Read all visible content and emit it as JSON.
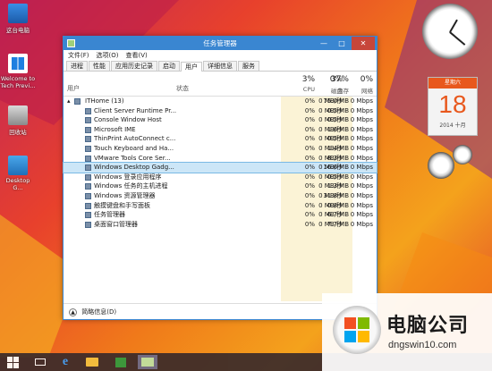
{
  "desktop": {
    "icons": [
      {
        "label": "这台电脑",
        "icon": "computer-icon"
      },
      {
        "label": "Welcome to Tech Previ...",
        "icon": "windows-icon"
      },
      {
        "label": "回收站",
        "icon": "recycle-bin-icon"
      },
      {
        "label": "Desktop G...",
        "icon": "desktop-gadgets-icon"
      }
    ],
    "calendar": {
      "weekday": "星期六",
      "day": "18",
      "year_month": "2014 十月"
    }
  },
  "window": {
    "title": "任务管理器",
    "controls": {
      "minimize": "—",
      "maximize": "□",
      "close": "✕"
    }
  },
  "menu": [
    "文件(F)",
    "选项(O)",
    "查看(V)"
  ],
  "tabs": [
    "进程",
    "性能",
    "应用历史记录",
    "启动",
    "用户",
    "详细信息",
    "服务"
  ],
  "active_tab": "用户",
  "columns": {
    "user": "用户",
    "status": "状态",
    "cpu_pct": "3%",
    "cpu": "CPU",
    "mem_pct": "37%",
    "mem": "内存",
    "disk_pct": "0%",
    "disk": "磁盘",
    "net_pct": "0%",
    "net": "网络"
  },
  "rows": [
    {
      "name": "ITHome (13)",
      "cpu": "0%",
      "mem": "75.0 MB",
      "disk": "0 MB/秒",
      "net": "0 Mbps",
      "group": true
    },
    {
      "name": "Client Server Runtime Pr...",
      "cpu": "0%",
      "mem": "0.5 MB",
      "disk": "0 MB/秒",
      "net": "0 Mbps"
    },
    {
      "name": "Console Window Host",
      "cpu": "0%",
      "mem": "0.5 MB",
      "disk": "0 MB/秒",
      "net": "0 Mbps"
    },
    {
      "name": "Microsoft IME",
      "cpu": "0%",
      "mem": "1.6 MB",
      "disk": "0 MB/秒",
      "net": "0 Mbps"
    },
    {
      "name": "ThinPrint AutoConnect c...",
      "cpu": "0%",
      "mem": "0.5 MB",
      "disk": "0 MB/秒",
      "net": "0 Mbps"
    },
    {
      "name": "Touch Keyboard and Ha...",
      "cpu": "0%",
      "mem": "1.4 MB",
      "disk": "0 MB/秒",
      "net": "0 Mbps"
    },
    {
      "name": "VMware Tools Core Ser...",
      "cpu": "0%",
      "mem": "8.3 MB",
      "disk": "0 MB/秒",
      "net": "0 Mbps"
    },
    {
      "name": "Windows Desktop Gadg...",
      "cpu": "0%",
      "mem": "16.6 MB",
      "disk": "0 MB/秒",
      "net": "0 Mbps",
      "selected": true
    },
    {
      "name": "Windows 登录应用程序",
      "cpu": "0%",
      "mem": "0.5 MB",
      "disk": "0 MB/秒",
      "net": "0 Mbps"
    },
    {
      "name": "Windows 任务的主机进程",
      "cpu": "0%",
      "mem": "1.3 MB",
      "disk": "0 MB/秒",
      "net": "0 Mbps"
    },
    {
      "name": "Windows 资源管理器",
      "cpu": "0%",
      "mem": "31.8 MB",
      "disk": "0 MB/秒",
      "net": "0 Mbps"
    },
    {
      "name": "触摸键盘和手写面板",
      "cpu": "0%",
      "mem": "0.8 MB",
      "disk": "0 MB/秒",
      "net": "0 Mbps"
    },
    {
      "name": "任务管理器",
      "cpu": "0%",
      "mem": "6.7 MB",
      "disk": "0 MB/秒",
      "net": "0 Mbps"
    },
    {
      "name": "桌面窗口管理器",
      "cpu": "0%",
      "mem": "7.7 MB",
      "disk": "0 MB/秒",
      "net": "0 Mbps"
    }
  ],
  "footer": {
    "label": "简略信息(D)"
  },
  "watermark": {
    "brand": "电脑公司",
    "url": "dngswin10.com"
  },
  "colors": {
    "accent": "#3a86d1",
    "close": "#c7463a",
    "calendar": "#e8581d"
  }
}
